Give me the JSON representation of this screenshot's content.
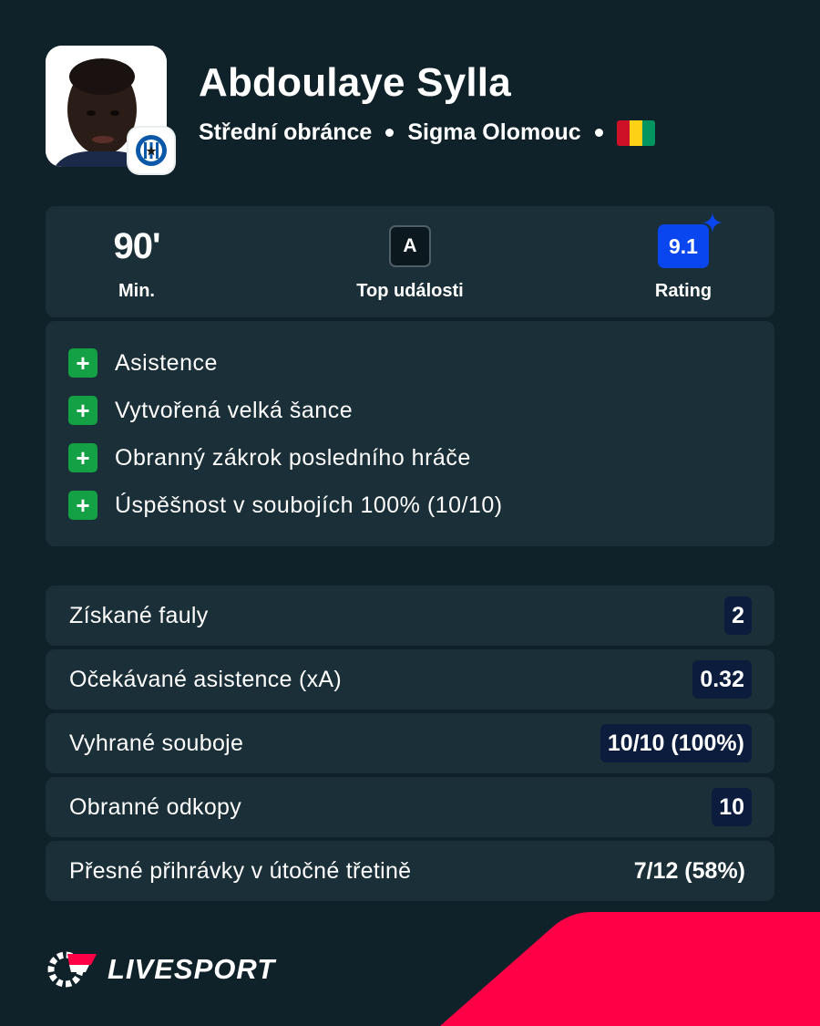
{
  "player": {
    "name": "Abdoulaye Sylla",
    "position": "Střední obránce",
    "club": "Sigma Olomouc",
    "flag_colors": [
      "#ce1126",
      "#fcd116",
      "#009460"
    ]
  },
  "summary": {
    "minutes_value": "90'",
    "minutes_label": "Min.",
    "events_badge": "A",
    "events_label": "Top události",
    "rating_value": "9.1",
    "rating_label": "Rating"
  },
  "highlights": [
    "Asistence",
    "Vytvořená velká šance",
    "Obranný zákrok posledního hráče",
    "Úspěšnost v soubojích 100% (10/10)"
  ],
  "stats": [
    {
      "label": "Získané fauly",
      "value": "2"
    },
    {
      "label": "Očekávané asistence (xA)",
      "value": "0.32"
    },
    {
      "label": "Vyhrané souboje",
      "value": "10/10 (100%)"
    },
    {
      "label": "Obranné odkopy",
      "value": "10"
    },
    {
      "label": "Přesné přihrávky v útočné třetině",
      "value": "7/12 (58%)"
    }
  ],
  "brand": {
    "name": "LIVESPORT",
    "accent": "#ff0046"
  },
  "colors": {
    "background": "#0f2229",
    "panel": "#1a2f37",
    "rating": "#0a46f0",
    "plus": "#14a044",
    "stat_badge": "#0c1c3d"
  }
}
